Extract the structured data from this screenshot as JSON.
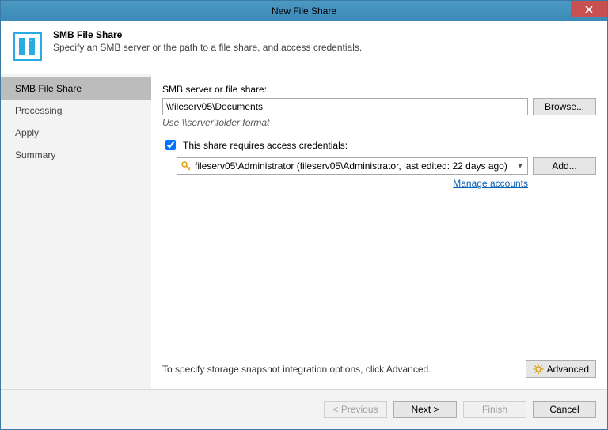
{
  "window": {
    "title": "New File Share"
  },
  "header": {
    "title": "SMB File Share",
    "subtitle": "Specify an SMB server or the path to a file share, and access credentials."
  },
  "sidebar": {
    "items": [
      {
        "label": "SMB File Share",
        "active": true
      },
      {
        "label": "Processing",
        "active": false
      },
      {
        "label": "Apply",
        "active": false
      },
      {
        "label": "Summary",
        "active": false
      }
    ]
  },
  "content": {
    "path_label": "SMB server or file share:",
    "path_value": "\\\\fileserv05\\Documents",
    "browse_label": "Browse...",
    "path_hint": "Use \\\\server\\folder format",
    "creds_checkbox_label": "This share requires access credentials:",
    "creds_checked": true,
    "creds_selected": "fileserv05\\Administrator (fileserv05\\Administrator, last edited: 22 days ago)",
    "add_label": "Add...",
    "manage_link": "Manage accounts",
    "advanced_hint": "To specify storage snapshot integration options, click Advanced.",
    "advanced_label": "Advanced"
  },
  "footer": {
    "previous": "< Previous",
    "next": "Next >",
    "finish": "Finish",
    "cancel": "Cancel"
  }
}
